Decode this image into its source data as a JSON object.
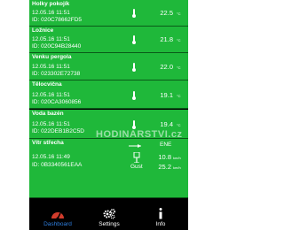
{
  "sensors": [
    {
      "name": "Holky pokojík",
      "date": "12.05.16  11:51",
      "id": "ID: 020C78662FD5",
      "value": "22.5",
      "unit": "°C"
    },
    {
      "name": "Ložnice",
      "date": "12.05.16  11:51",
      "id": "ID: 020C94B28440",
      "value": "21.8",
      "unit": "°C"
    },
    {
      "name": "Venku pergola",
      "date": "12.05.16  11:51",
      "id": "ID: 023302E72738",
      "value": "22.0",
      "unit": "°C"
    },
    {
      "name": "Tělocvična",
      "date": "12.05.16  11:51",
      "id": "ID: 020CA3060856",
      "value": "19.1",
      "unit": "°C"
    },
    {
      "name": "Voda bazén",
      "date": "12.05.16  11:51",
      "id": "ID: 022DEB1B2C5D",
      "value": "19.4",
      "unit": "°C"
    }
  ],
  "wind": {
    "name": "Vítr střecha",
    "date": "12.05.16  11:49",
    "id": "ID: 0B3340561EAA",
    "direction": "ENE",
    "speed": "10.8",
    "speed_unit": "km/h",
    "gust_label": "Gust",
    "gust": "25.2",
    "gust_unit": "km/h"
  },
  "watermark": "HODINARSTVI.cz",
  "nav": {
    "dashboard": "Dashboard",
    "settings": "Settings",
    "info": "Info"
  },
  "colors": {
    "card_green": "#1fb83a",
    "active_tab": "#2f7fe0",
    "dashboard_icon": "#d23c2c"
  },
  "icons": [
    "thermometer-icon",
    "wind-icon",
    "gauge-icon",
    "gears-icon",
    "info-icon"
  ]
}
